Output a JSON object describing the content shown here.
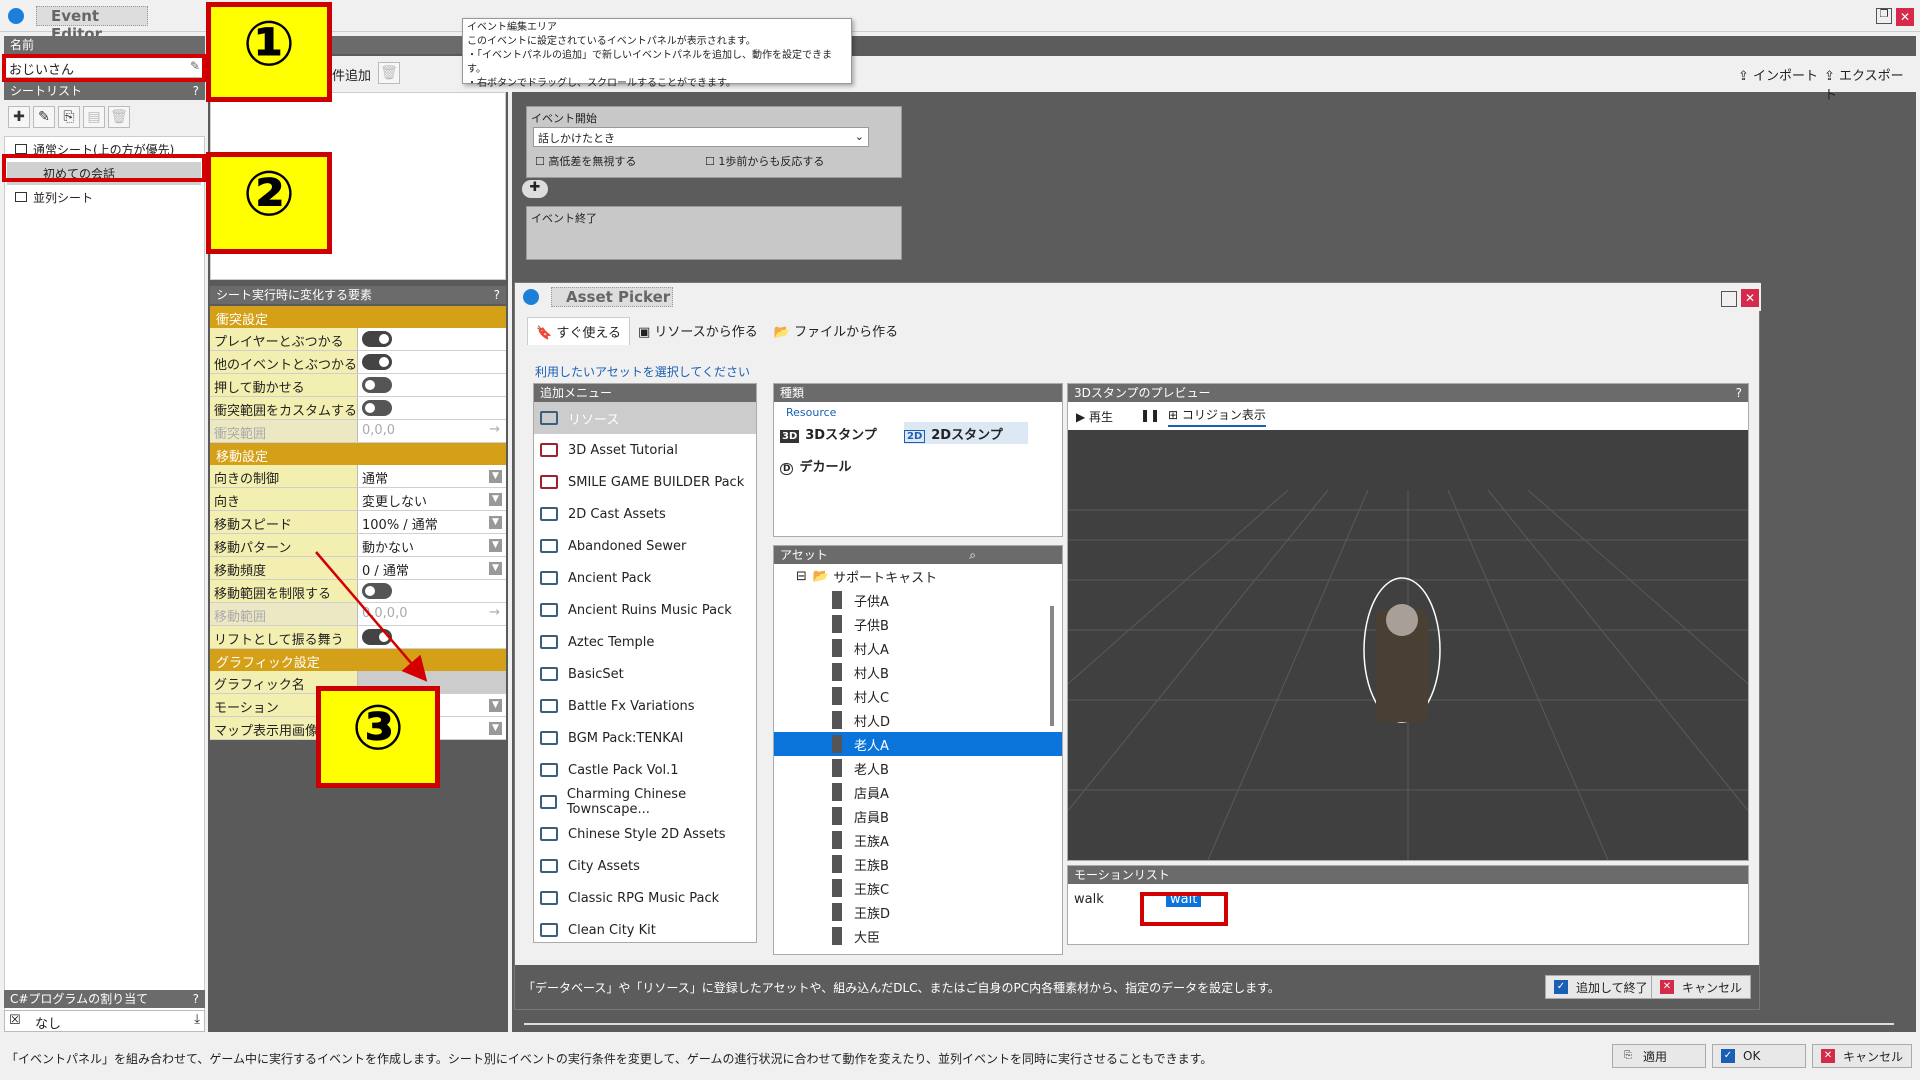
{
  "window": {
    "title": "Event Editor"
  },
  "left": {
    "name_label": "名前",
    "name_value": "おじいさん",
    "sheet_list_label": "シートリスト",
    "sheet_items": [
      "通常シート(上の方が優先)",
      "初めての会話",
      "並列シート"
    ],
    "csharp_label": "C#プログラムの割り当て",
    "csharp_value": "なし"
  },
  "middle": {
    "add_label": "件追加",
    "props_label": "シート実行時に変化する要素",
    "sections": {
      "collision": "衝突設定",
      "movement": "移動設定",
      "graphic": "グラフィック設定"
    },
    "rows": {
      "player_hit": "プレイヤーとぶつかる",
      "event_hit": "他のイベントとぶつかる",
      "push_move": "押して動かせる",
      "custom_range": "衝突範囲をカスタムする",
      "collision_range": "衝突範囲",
      "collision_range_val": "0,0,0",
      "dir_ctrl": "向きの制御",
      "dir_ctrl_val": "通常",
      "dir": "向き",
      "dir_val": "変更しない",
      "speed": "移動スピード",
      "speed_val": "100% / 通常",
      "pattern": "移動パターン",
      "pattern_val": "動かない",
      "freq": "移動頻度",
      "freq_val": "0 / 通常",
      "limit": "移動範囲を制限する",
      "range": "移動範囲",
      "range_val": "0,0,0,0",
      "lift": "リフトとして振る舞う",
      "graphic_name": "グラフィック名",
      "motion": "モーション",
      "map_img": "マップ表示用画像"
    }
  },
  "event_area": {
    "tooltip": [
      "イベント編集エリア",
      "このイベントに設定されているイベントパネルが表示されます。",
      "・「イベントパネルの追加」で新しいイベントパネルを追加し、動作を設定できます。",
      "・右ボタンでドラッグし、スクロールすることができます。"
    ],
    "import": "インポート",
    "export": "エクスポート",
    "start_label": "イベント開始",
    "trigger": "話しかけたとき",
    "ignore_height": "高低差を無視する",
    "one_step": "1歩前からも反応する",
    "end_label": "イベント終了"
  },
  "asset_picker": {
    "title": "Asset Picker",
    "tabs": [
      "すぐ使える",
      "リソースから作る",
      "ファイルから作る"
    ],
    "instruction": "利用したいアセットを選択してください",
    "add_menu_label": "追加メニュー",
    "menu_items": [
      "リソース",
      "3D Asset Tutorial",
      "SMILE GAME BUILDER Pack",
      "2D Cast Assets",
      "Abandoned Sewer",
      "Ancient Pack",
      "Ancient Ruins Music Pack",
      "Aztec Temple",
      "BasicSet",
      "Battle Fx Variations",
      "BGM Pack:TENKAI",
      "Castle Pack Vol.1",
      "Charming Chinese Townscape...",
      "Chinese Style 2D Assets",
      "City Assets",
      "Classic RPG Music Pack",
      "Clean City Kit"
    ],
    "kind_label": "種類",
    "resource_label": "Resource",
    "kinds": [
      "3Dスタンプ",
      "2Dスタンプ",
      "デカール"
    ],
    "asset_label": "アセット",
    "tree_root": "サポートキャスト",
    "tree_items": [
      "子供A",
      "子供B",
      "村人A",
      "村人B",
      "村人C",
      "村人D",
      "老人A",
      "老人B",
      "店員A",
      "店員B",
      "王族A",
      "王族B",
      "王族C",
      "王族D",
      "大臣"
    ],
    "selected_item": "老人A",
    "preview_label": "3Dスタンプのプレビュー",
    "play": "再生",
    "collision_show": "コリジョン表示",
    "motion_list_label": "モーションリスト",
    "motions": [
      "walk",
      "wait"
    ],
    "footer": "「データベース」や「リソース」に登録したアセットや、組み込んだDLC、またはご自身のPC内各種素材から、指定のデータを設定します。",
    "add_finish": "追加して終了",
    "cancel": "キャンセル"
  },
  "status": {
    "text": "「イベントパネル」を組み合わせて、ゲーム中に実行するイベントを作成します。シート別にイベントの実行条件を変更して、ゲームの進行状況に合わせて動作を変えたり、並列イベントを同時に実行させることもできます。",
    "apply": "適用",
    "ok": "OK",
    "cancel": "キャンセル"
  },
  "callouts": [
    "①",
    "②",
    "③"
  ],
  "colors": {
    "accent_red": "#d40000",
    "callout_yellow": "#ffff00",
    "selection_blue": "#0a74da",
    "section_gold": "#d4a017"
  }
}
